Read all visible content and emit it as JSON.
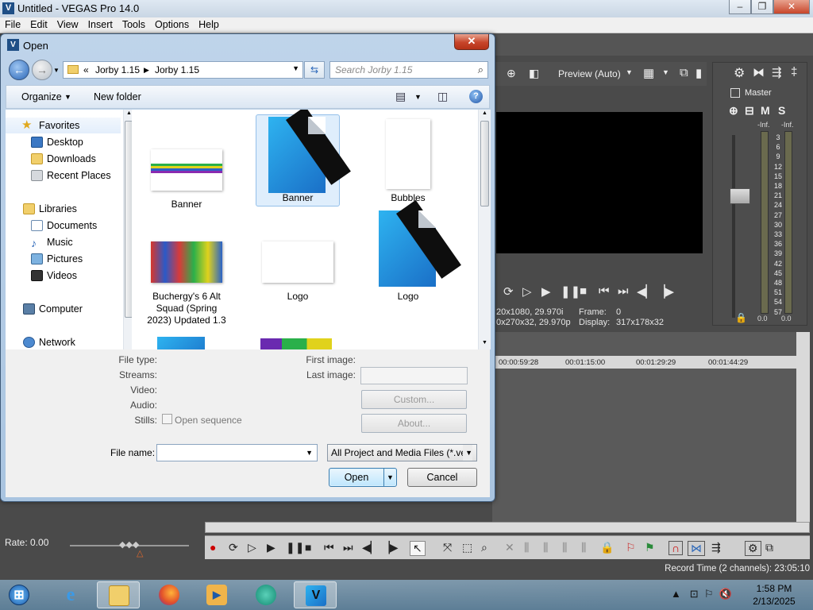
{
  "vegas": {
    "title": "Untitled - VEGAS Pro 14.0",
    "logo": "V",
    "menu": [
      "File",
      "Edit",
      "View",
      "Insert",
      "Tools",
      "Options",
      "Help"
    ],
    "preview_quality": "Preview (Auto)",
    "preview_info": {
      "project": "20x1080, 29.970i",
      "frame_label": "Frame:",
      "frame_value": "0",
      "preview": "0x270x32, 29.970p",
      "display_label": "Display:",
      "display_value": "317x178x32"
    },
    "mixer": {
      "master_label": "Master",
      "m": "M",
      "s": "S",
      "inf_left": "-Inf.",
      "inf_right": "-Inf.",
      "scale": [
        "3",
        "6",
        "9",
        "12",
        "15",
        "18",
        "21",
        "24",
        "27",
        "30",
        "33",
        "36",
        "39",
        "42",
        "45",
        "48",
        "51",
        "54",
        "57"
      ],
      "level_left": "0.0",
      "level_right": "0.0"
    },
    "ruler": [
      "00:00:59:28",
      "00:01:15:00",
      "00:01:29:29",
      "00:01:44:29"
    ],
    "rate": "Rate: 0.00",
    "record_time": "Record Time (2 channels): 23:05:10"
  },
  "dialog": {
    "title": "Open",
    "close_glyph": "✕",
    "breadcrumb": [
      "Jorby 1.15",
      "Jorby 1.15"
    ],
    "search_placeholder": "Search Jorby 1.15",
    "organize": "Organize",
    "new_folder": "New folder",
    "nav": {
      "favorites": "Favorites",
      "desktop": "Desktop",
      "downloads": "Downloads",
      "recent": "Recent Places",
      "libraries": "Libraries",
      "documents": "Documents",
      "music": "Music",
      "pictures": "Pictures",
      "videos": "Videos",
      "computer": "Computer",
      "network": "Network"
    },
    "files": [
      {
        "name": "Banner"
      },
      {
        "name": "Banner"
      },
      {
        "name": "Bubbles"
      },
      {
        "name": "Buchergy's 6 Alt Squad (Spring 2023) Updated 1.3"
      },
      {
        "name": "Logo"
      },
      {
        "name": "Logo"
      }
    ],
    "details": {
      "file_type": "File type:",
      "streams": "Streams:",
      "video": "Video:",
      "audio": "Audio:",
      "stills": "Stills:",
      "open_sequence": "Open sequence",
      "first_image": "First image:",
      "last_image": "Last image:",
      "custom": "Custom...",
      "about": "About..."
    },
    "file_name_label": "File name:",
    "file_name_value": "",
    "file_type_filter": "All Project and Media Files (*.ve",
    "open": "Open",
    "cancel": "Cancel"
  },
  "taskbar": {
    "time": "1:58 PM",
    "date": "2/13/2025"
  },
  "colors": {
    "accent": "#2a66b8",
    "vegas_blue": "#1a8fe0",
    "close_red": "#c7452a"
  }
}
